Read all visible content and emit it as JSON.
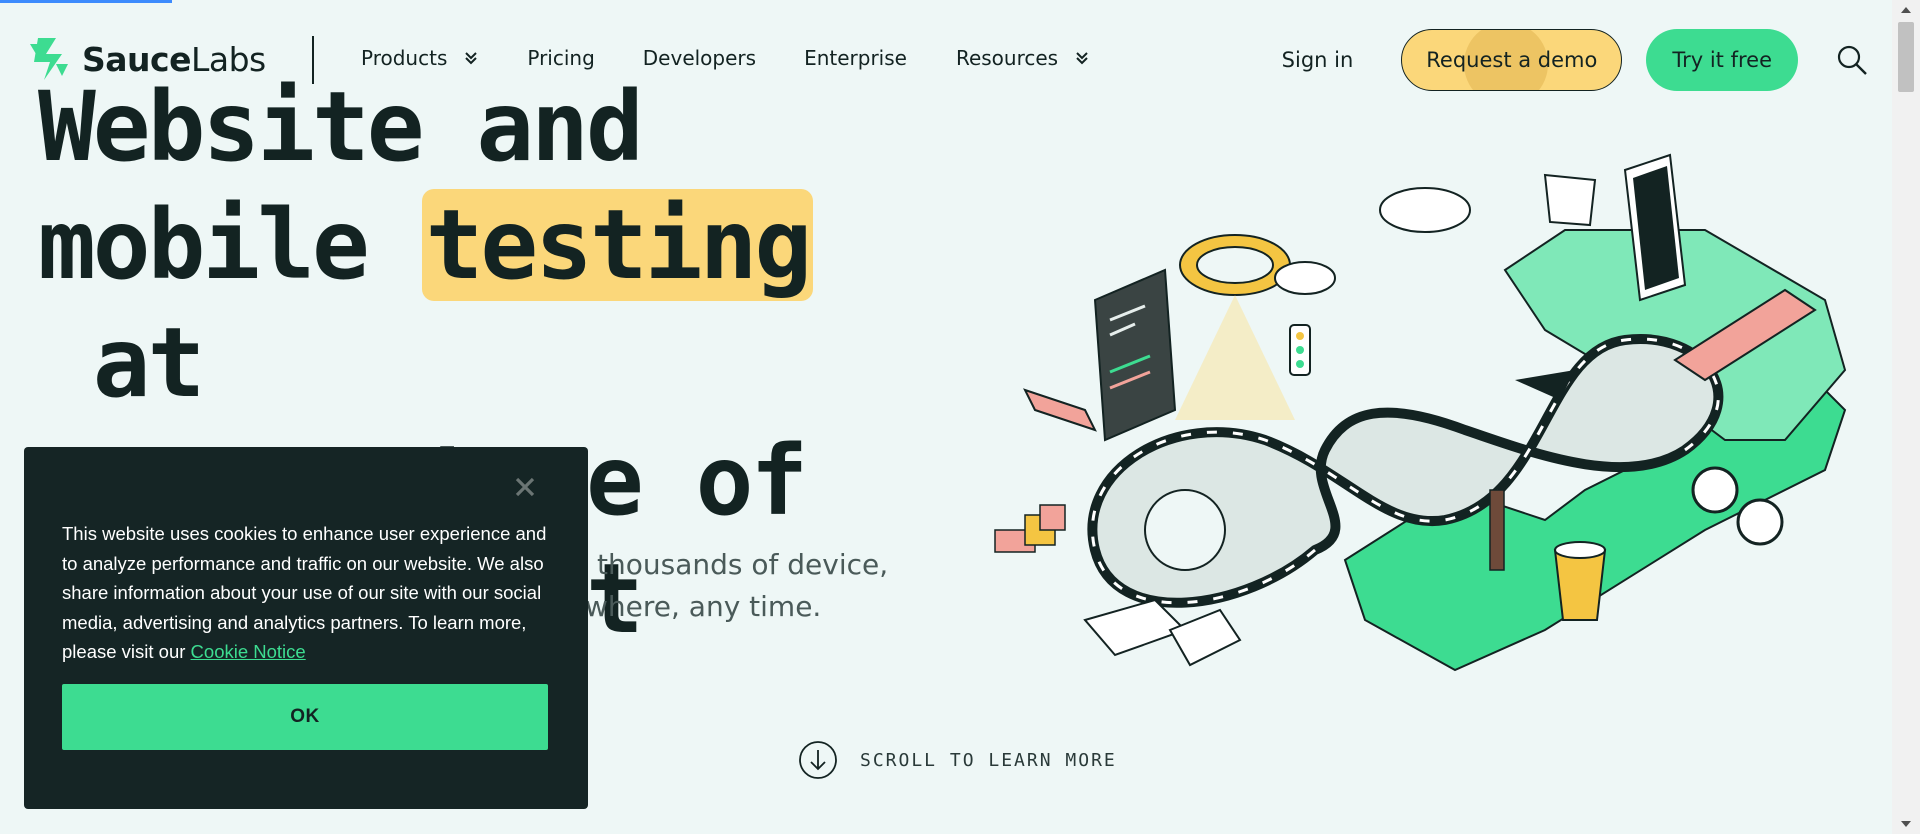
{
  "nav": {
    "brand_bold": "Sauce",
    "brand_light": "Labs",
    "links": [
      {
        "label": "Products",
        "dropdown": true
      },
      {
        "label": "Pricing",
        "dropdown": false
      },
      {
        "label": "Developers",
        "dropdown": false
      },
      {
        "label": "Enterprise",
        "dropdown": false
      },
      {
        "label": "Resources",
        "dropdown": true
      }
    ],
    "sign_in": "Sign in",
    "request_demo": "Request a demo",
    "try_free": "Try it free"
  },
  "hero": {
    "title_line1": "Website and",
    "title_line2_pre": "mobile ",
    "title_line2_highlight": "testing",
    "title_line2_post": " at",
    "title_line3": "every stage of",
    "title_line4": "development",
    "subtitle_line1": "thousands of device,",
    "subtitle_line2": "where, any time."
  },
  "scroll": {
    "label": "SCROLL TO LEARN MORE"
  },
  "cookie": {
    "text": "This website uses cookies to enhance user experience and to analyze performance and traffic on our website. We also share information about your use of our site with our social media, advertising and analytics partners. To learn more, please visit our ",
    "link": "Cookie Notice",
    "ok": "OK"
  },
  "colors": {
    "background": "#eef7f6",
    "brand_green": "#3ddc91",
    "highlight_yellow": "#fbd77a",
    "dark": "#132322",
    "cookie_bg": "#152525"
  },
  "illustration_caption": "",
  "icons": {
    "logo": "saucelabs-logo-icon",
    "dropdown": "chevron-double-down-icon",
    "search": "search-icon",
    "scroll": "arrow-down-circle-icon",
    "close": "close-icon"
  }
}
